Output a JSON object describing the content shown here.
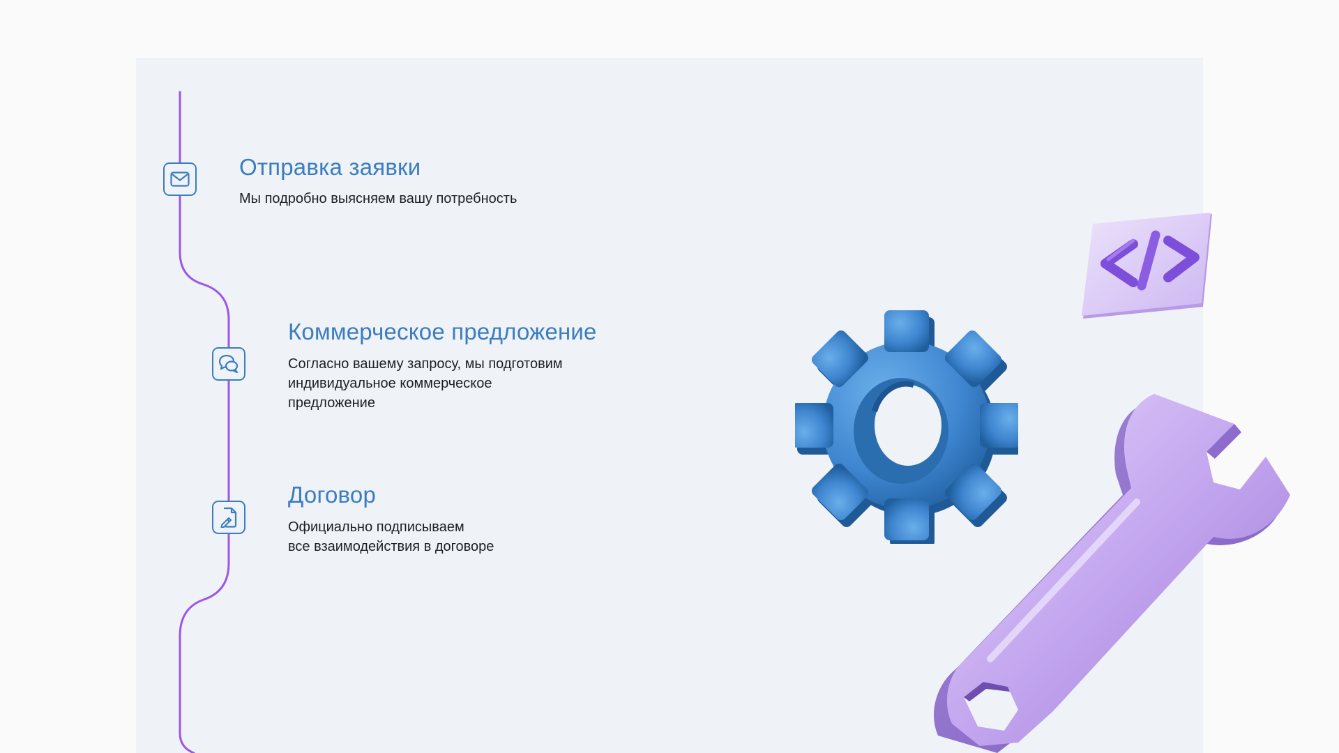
{
  "steps": [
    {
      "title": "Отправка заявки",
      "description": "Мы подробно выясняем вашу потребность",
      "icon": "mail-icon"
    },
    {
      "title": "Коммерческое предложение",
      "description": "Согласно вашему запросу, мы подготовим\nиндивидуальное коммерческое\nпредложение",
      "icon": "chat-bubbles-icon"
    },
    {
      "title": "Договор",
      "description": "Официально подписываем\nвсе взаимодействия в договоре",
      "icon": "document-sign-icon"
    }
  ],
  "colors": {
    "timeline": "#9b57e6",
    "accent": "#3a7dc0",
    "panel": "#eff2f7",
    "page": "#fafafb"
  },
  "illustrations": [
    "code-icon",
    "gear-icon",
    "wrench-icon"
  ]
}
